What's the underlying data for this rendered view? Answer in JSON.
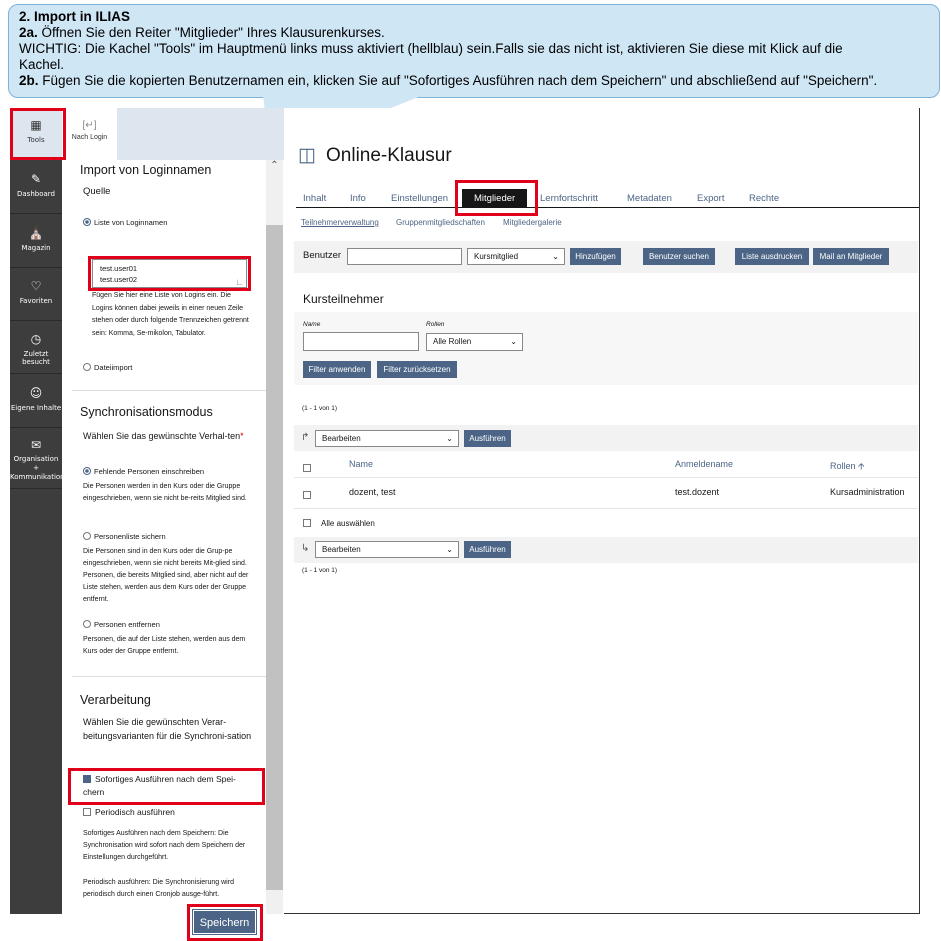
{
  "callout": {
    "heading": "2. Import in ILIAS",
    "step_a_label": "2a.",
    "step_a_text": " Öffnen Sie den Reiter \"Mitglieder\" Ihres Klausurenkurses.",
    "important_line1": "WICHTIG: Die Kachel \"Tools\" im Hauptmenü links muss aktiviert (hellblau) sein.Falls sie das nicht ist, aktivieren Sie diese mit Klick auf die",
    "important_line2": "Kachel.",
    "step_b_label": "2b.",
    "step_b_text": " Fügen Sie die kopierten Benutzernamen ein, klicken Sie auf \"Sofortiges Ausführen nach dem Speichern\" und abschließend auf \"Speichern\"."
  },
  "mainbar": {
    "tools": "Tools",
    "dashboard": "Dashboard",
    "magazin": "Magazin",
    "favoriten": "Favoriten",
    "zuletzt": "Zuletzt besucht",
    "eigene": "Eigene Inhalte",
    "organisation": "Organisation + Kommunikation"
  },
  "slate": {
    "nach_login": "Nach Login",
    "import_title": "Import von Loginnamen",
    "quelle": "Quelle",
    "liste_option": "Liste von Loginnamen",
    "textarea_line1": "test.user01",
    "textarea_line2": "test.user02",
    "help1": "Fügen Sie hier eine Liste von Logins ein. Die Logins können dabei jeweils in einer neuen Zeile stehen oder durch folgende Trennzeichen getrennt sein: Komma, Se-mikolon, Tabulator.",
    "dateiimport": "Dateiimport",
    "sync_title": "Synchronisationsmodus",
    "sync_question": "Wählen Sie das gewünschte Verhal-ten",
    "required_mark": "*",
    "opt1": "Fehlende Personen einschreiben",
    "opt1_help": "Die Personen werden in den Kurs oder die Gruppe eingeschrieben, wenn sie nicht be-reits Mitglied sind.",
    "opt2": "Personenliste sichern",
    "opt2_help": "Die Personen sind in den Kurs oder die Grup-pe eingeschrieben, wenn sie nicht bereits Mit-glied sind. Personen, die bereits Mitglied sind, aber nicht auf der Liste stehen, werden aus dem Kurs oder der Gruppe entfernt.",
    "opt3": "Personen entfernen",
    "opt3_help": "Personen, die auf der Liste stehen, werden aus dem Kurs oder der Gruppe entfernt.",
    "proc_title": "Verarbeitung",
    "proc_question": "Wählen Sie die gewünschten Verar-beitungsvarianten für die Synchroni-sation",
    "chk1": "Sofortiges Ausführen nach dem Spei-chern",
    "chk2": "Periodisch ausführen",
    "proc_help1": "Sofortiges Ausführen nach dem Speichern: Die Synchronisation wird sofort nach dem Speichern der Einstellungen durchgeführt.",
    "proc_help2": "Periodisch ausführen: Die Synchronisierung wird periodisch durch einen Cronjob ausge-führt.",
    "save": "Speichern"
  },
  "main": {
    "title": "Online-Klausur",
    "tabs": [
      "Inhalt",
      "Info",
      "Einstellungen",
      "Mitglieder",
      "Lernfortschritt",
      "Metadaten",
      "Export",
      "Rechte"
    ],
    "subtabs": [
      "Teilnehmerverwaltung",
      "Gruppenmitgliedschaften",
      "Mitgliedergalerie"
    ],
    "benutzer_label": "Benutzer",
    "role_select": "Kursmitglied",
    "btn_add": "Hinzufügen",
    "btn_search": "Benutzer suchen",
    "btn_print": "Liste ausdrucken",
    "btn_mail": "Mail an Mitglieder",
    "section_title": "Kursteilnehmer",
    "filter_name_label": "Name",
    "filter_role_label": "Rollen",
    "filter_role_value": "Alle Rollen",
    "btn_filter_apply": "Filter anwenden",
    "btn_filter_reset": "Filter zurücksetzen",
    "count_top": "(1 - 1 von 1)",
    "action_select": "Bearbeiten",
    "btn_execute": "Ausführen",
    "col_name": "Name",
    "col_login": "Anmeldename",
    "col_role": "Rollen",
    "row_name": "dozent, test",
    "row_login": "test.dozent",
    "row_role": "Kursadministration",
    "select_all": "Alle auswählen",
    "count_bottom": "(1 - 1 von 1)"
  }
}
